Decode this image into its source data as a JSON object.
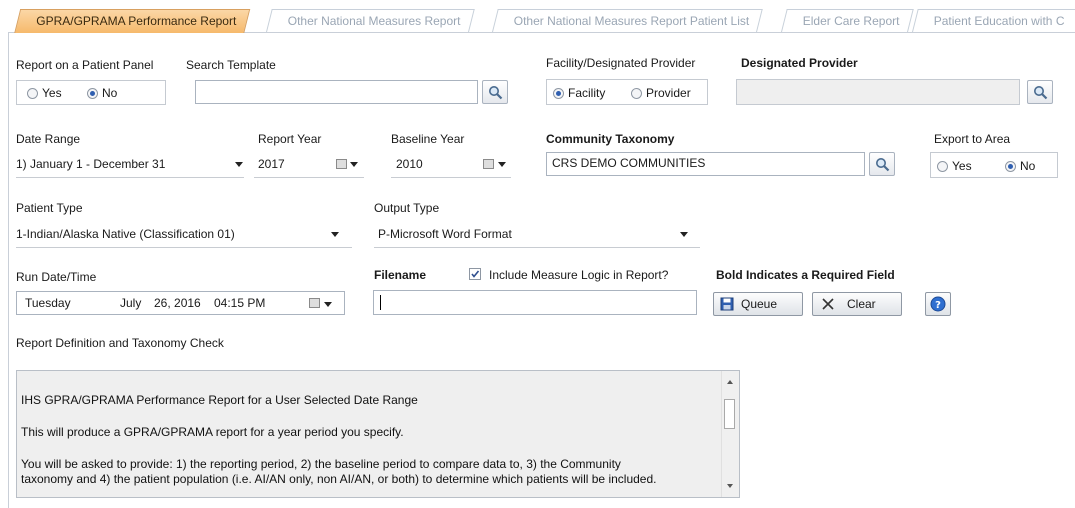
{
  "tabs": [
    {
      "label": "GPRA/GPRAMA Performance Report",
      "active": true
    },
    {
      "label": "Other National Measures Report",
      "active": false
    },
    {
      "label": "Other National Measures Report Patient List",
      "active": false
    },
    {
      "label": "Elder Care Report",
      "active": false
    },
    {
      "label": "Patient Education with C",
      "active": false
    }
  ],
  "panel_report": {
    "label": "Report on a Patient Panel",
    "yes": "Yes",
    "no": "No",
    "selected": "No"
  },
  "search_template": {
    "label": "Search Template",
    "value": ""
  },
  "facility_provider": {
    "label": "Facility/Designated Provider",
    "facility": "Facility",
    "provider": "Provider",
    "selected": "Facility"
  },
  "designated_provider": {
    "label": "Designated Provider",
    "value": ""
  },
  "date_range": {
    "label": "Date Range",
    "value": "1) January 1 - December 31"
  },
  "report_year": {
    "label": "Report Year",
    "value": "2017"
  },
  "baseline_year": {
    "label": "Baseline Year",
    "value": "2010"
  },
  "community_taxonomy": {
    "label": "Community Taxonomy",
    "value": "CRS DEMO COMMUNITIES"
  },
  "export_area": {
    "label": "Export to Area",
    "yes": "Yes",
    "no": "No",
    "selected": "No"
  },
  "patient_type": {
    "label": "Patient Type",
    "value": "1-Indian/Alaska Native (Classification 01)"
  },
  "output_type": {
    "label": "Output Type",
    "value": "P-Microsoft Word Format"
  },
  "run_date": {
    "label": "Run Date/Time",
    "weekday": "Tuesday",
    "month": "July",
    "dayyear": "26, 2016",
    "time": "04:15 PM"
  },
  "filename": {
    "label": "Filename",
    "value": ""
  },
  "include_logic": {
    "label": "Include Measure Logic in Report?",
    "checked": true
  },
  "required_note": "Bold Indicates a Required Field",
  "buttons": {
    "queue": "Queue",
    "clear": "Clear"
  },
  "definition": {
    "label": "Report Definition and Taxonomy Check",
    "line1": "IHS GPRA/GPRAMA Performance Report for a User Selected Date Range",
    "line2": "This will produce a GPRA/GPRAMA report for a year period you specify.",
    "line3": "You will be asked to provide: 1) the reporting period, 2) the baseline period to compare data to, 3) the Community",
    "line4": "taxonomy and 4) the patient population (i.e. AI/AN only, non AI/AN, or both) to determine which patients will be included."
  },
  "colors": {
    "active_tab": "#f6b869",
    "radio_selected": "#2f5fb0"
  }
}
